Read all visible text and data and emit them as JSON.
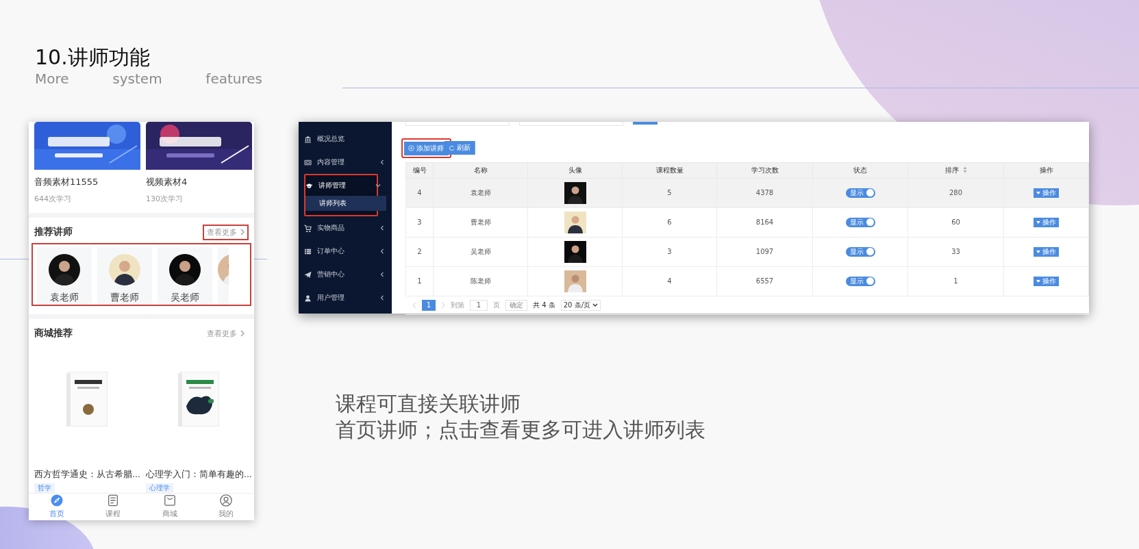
{
  "slide": {
    "title": "10.讲师功能",
    "subtitle_words": [
      "More",
      "system",
      "features"
    ],
    "caption_lines": [
      "课程可直接关联讲师",
      "首页讲师；点击查看更多可进入讲师列表"
    ]
  },
  "phone": {
    "courses": [
      {
        "title": "音频素材11555",
        "count": "644次学习"
      },
      {
        "title": "视频素材4",
        "count": "130次学习"
      }
    ],
    "teacher_section": {
      "title": "推荐讲师",
      "more": "查看更多",
      "more_highlighted": true,
      "list_highlighted": true
    },
    "teachers": [
      {
        "name": "袁老师",
        "cut_off": false
      },
      {
        "name": "曹老师",
        "cut_off": false
      },
      {
        "name": "吴老师",
        "cut_off": false
      },
      {
        "cut_off": true
      }
    ],
    "shop_section": {
      "title": "商城推荐",
      "more": "查看更多"
    },
    "products": [
      {
        "title": "西方哲学通史：从古希腊...",
        "tag": "哲学"
      },
      {
        "title": "心理学入门：简单有趣的...",
        "tag": "心理学"
      }
    ],
    "tabs": [
      {
        "label": "首页",
        "kind": "compass",
        "selected": true
      },
      {
        "label": "课程",
        "kind": "doc",
        "selected": false
      },
      {
        "label": "商城",
        "kind": "bag",
        "selected": false
      },
      {
        "label": "我的",
        "kind": "user",
        "selected": false
      }
    ]
  },
  "admin": {
    "sidebar": [
      {
        "label": "概况总览",
        "kind": "link",
        "expanded": false,
        "highlighted": false
      },
      {
        "label": "内容管理",
        "kind": "group",
        "expanded": false,
        "highlighted": false
      },
      {
        "label": "讲师管理",
        "kind": "group",
        "expanded": true,
        "highlighted": true,
        "children": [
          {
            "label": "讲师列表",
            "selected": true
          }
        ]
      },
      {
        "label": "实物商品",
        "kind": "group",
        "expanded": false,
        "highlighted": false
      },
      {
        "label": "订单中心",
        "kind": "group",
        "expanded": false,
        "highlighted": false
      },
      {
        "label": "营销中心",
        "kind": "group",
        "expanded": false,
        "highlighted": false
      },
      {
        "label": "用户管理",
        "kind": "group",
        "expanded": false,
        "highlighted": false
      }
    ],
    "buttons": [
      {
        "label": "添加讲师",
        "kind": "add",
        "highlighted": true
      },
      {
        "label": "刷新",
        "kind": "refresh",
        "highlighted": false
      }
    ],
    "columns": [
      {
        "label": "编号",
        "sortable": false
      },
      {
        "label": "名称",
        "sortable": false
      },
      {
        "label": "头像",
        "sortable": false
      },
      {
        "label": "课程数量",
        "sortable": false
      },
      {
        "label": "学习次数",
        "sortable": false
      },
      {
        "label": "状态",
        "sortable": false
      },
      {
        "label": "排序",
        "sortable": true
      },
      {
        "label": "操作",
        "sortable": false
      }
    ],
    "rows": [
      {
        "id": "4",
        "name": "袁老师",
        "courses": "5",
        "views": "4378",
        "status": "显示",
        "on": true,
        "sort": "280",
        "action": "操作",
        "selected": true
      },
      {
        "id": "3",
        "name": "曹老师",
        "courses": "6",
        "views": "8164",
        "status": "显示",
        "on": true,
        "sort": "60",
        "action": "操作",
        "selected": false
      },
      {
        "id": "2",
        "name": "吴老师",
        "courses": "3",
        "views": "1097",
        "status": "显示",
        "on": true,
        "sort": "33",
        "action": "操作",
        "selected": false
      },
      {
        "id": "1",
        "name": "陈老师",
        "courses": "4",
        "views": "6557",
        "status": "显示",
        "on": true,
        "sort": "1",
        "action": "操作",
        "selected": false
      }
    ],
    "pagination": {
      "page": "1",
      "goto_label": "到第",
      "goto_value": "1",
      "page_unit": "页",
      "confirm": "确定",
      "total": "共 4 条",
      "page_size": "20 条/页"
    }
  }
}
